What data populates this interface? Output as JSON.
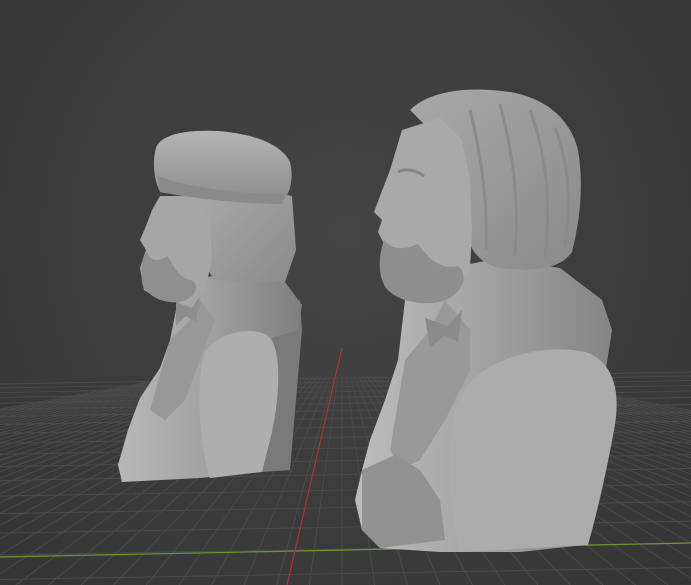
{
  "viewport": {
    "view": "perspective",
    "background_color": "#3d3d3d",
    "grid_color": "#4a4a4a",
    "x_axis_color": "#6a9a2a",
    "y_axis_color": "#b0303a",
    "objects": [
      {
        "name": "bust-with-cap",
        "material_color": "#9a9a9a"
      },
      {
        "name": "bust-with-long-hair",
        "material_color": "#9a9a9a"
      }
    ]
  }
}
